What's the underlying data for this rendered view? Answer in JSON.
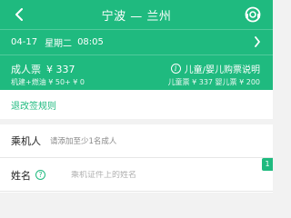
{
  "colors": {
    "brand": "#1fba7f",
    "background": "#f2f2f2"
  },
  "nav": {
    "title": "宁波 — 兰州",
    "back_icon": "chevron-left-icon",
    "service_icon": "customer-service-icon"
  },
  "trip": {
    "date": "04-17",
    "weekday": "星期二",
    "time": "08:05"
  },
  "pricing": {
    "adult_label": "成人票",
    "adult_price": "¥ 337",
    "fees": "机建+燃油 ¥ 50+ ¥ 0",
    "child_label": "儿童/婴儿购票说明",
    "child_prices": "儿童票 ¥ 337 婴儿票 ¥ 200"
  },
  "rules_link": "退改签规则",
  "form": {
    "passenger_label": "乘机人",
    "passenger_hint": "请添加至少1名成人",
    "name_label": "姓名",
    "name_placeholder": "乘机证件上的姓名",
    "corner_tab": "1"
  }
}
